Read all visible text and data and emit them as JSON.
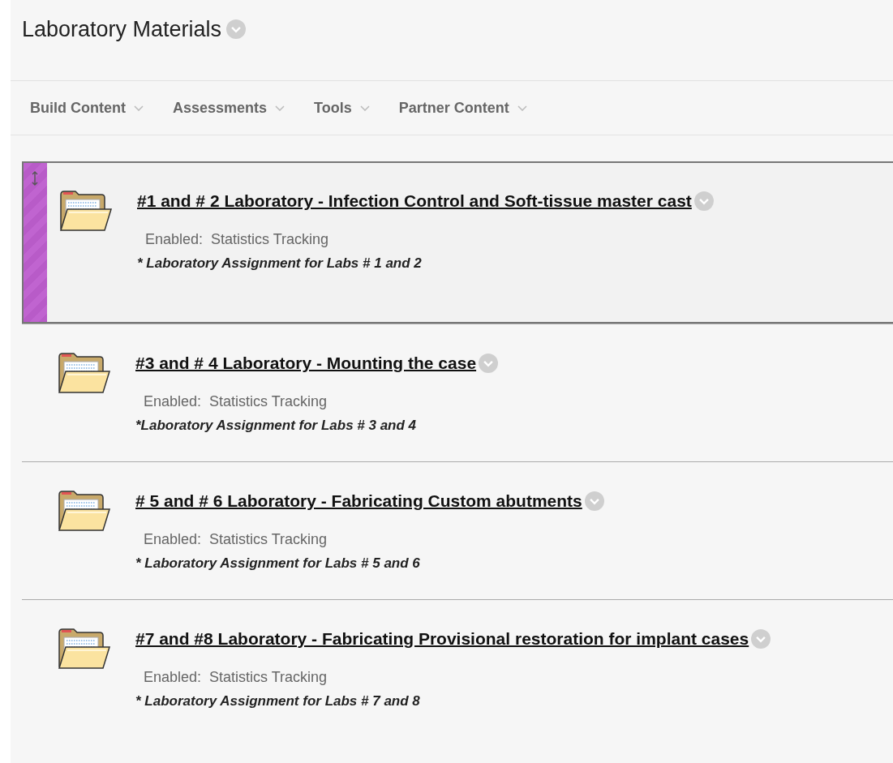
{
  "page": {
    "title": "Laboratory Materials"
  },
  "toolbar": [
    {
      "label": "Build Content"
    },
    {
      "label": "Assessments"
    },
    {
      "label": "Tools"
    },
    {
      "label": "Partner Content"
    }
  ],
  "items": [
    {
      "title": "#1 and # 2 Laboratory - Infection Control and Soft-tissue master cast",
      "selected": true,
      "enabled_label": "Enabled:",
      "enabled_value": "Statistics Tracking",
      "description": "* Laboratory Assignment for Labs # 1 and 2"
    },
    {
      "title": "#3 and # 4 Laboratory - Mounting the case",
      "selected": false,
      "enabled_label": "Enabled:",
      "enabled_value": "Statistics Tracking",
      "description": "*Laboratory Assignment for Labs # 3 and 4"
    },
    {
      "title": "# 5 and # 6 Laboratory - Fabricating Custom abutments",
      "selected": false,
      "enabled_label": "Enabled:",
      "enabled_value": "Statistics Tracking",
      "description": "* Laboratory Assignment for Labs # 5 and 6"
    },
    {
      "title": "#7 and #8 Laboratory - Fabricating Provisional restoration for implant cases",
      "selected": false,
      "enabled_label": "Enabled:",
      "enabled_value": "Statistics Tracking",
      "description": "* Laboratory Assignment for Labs # 7 and 8"
    }
  ]
}
